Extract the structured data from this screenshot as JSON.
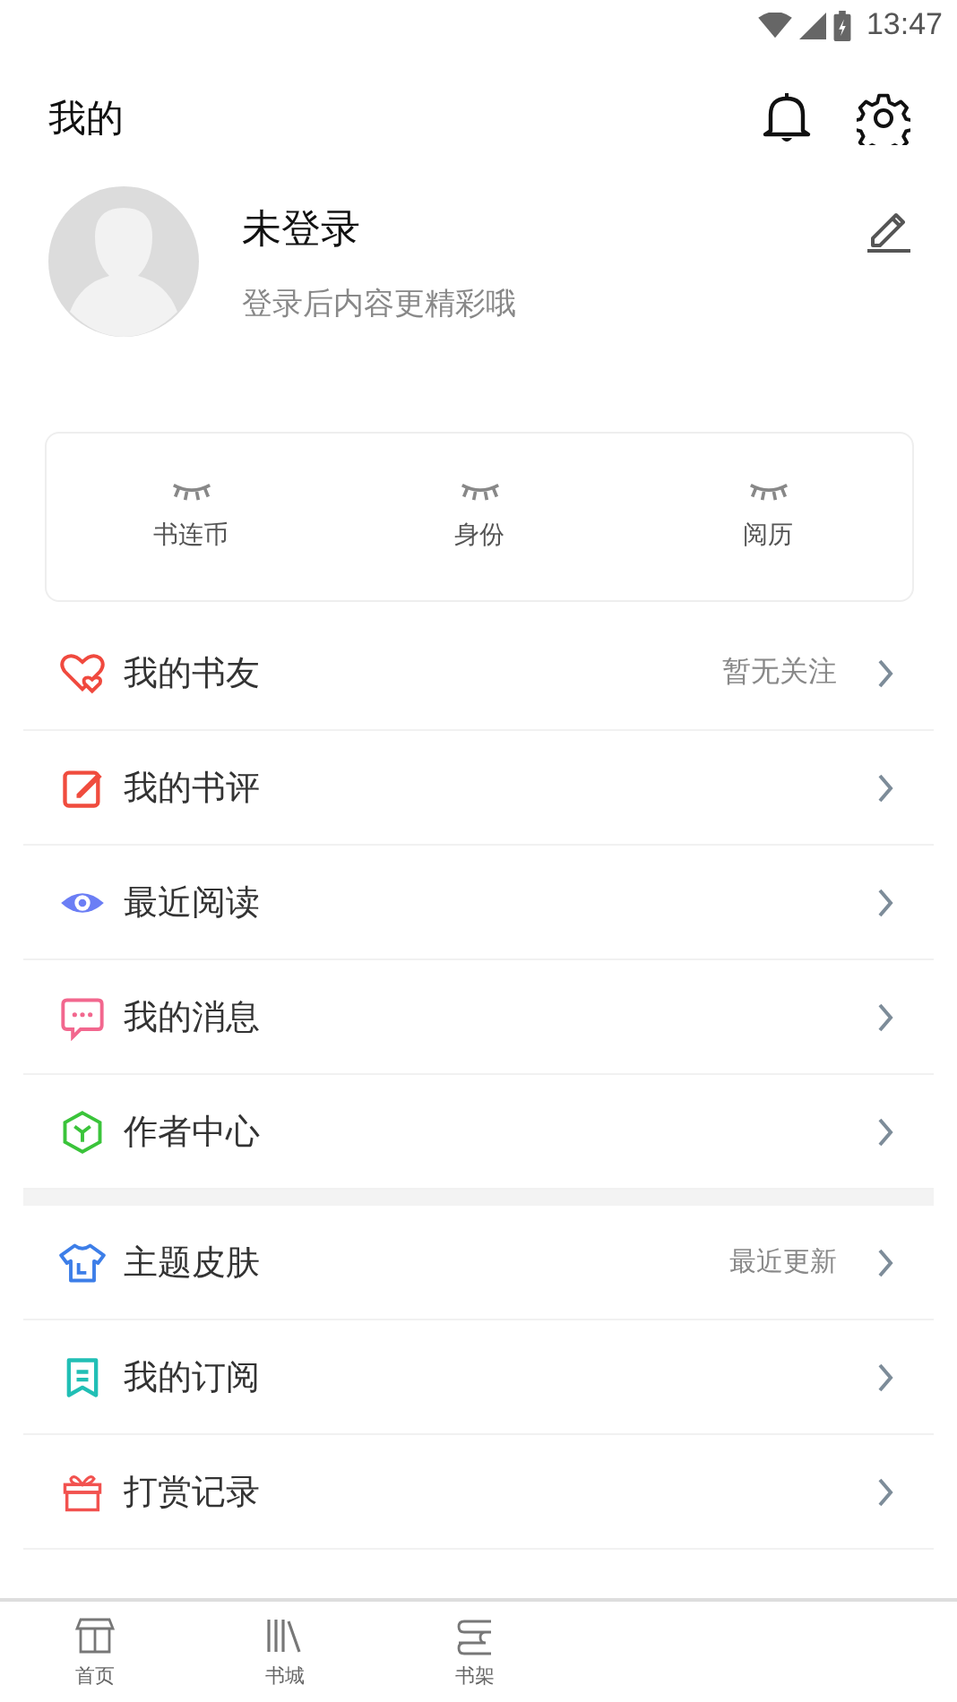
{
  "status_bar": {
    "time": "13:47"
  },
  "header": {
    "title": "我的"
  },
  "profile": {
    "name": "未登录",
    "hint": "登录后内容更精彩哦"
  },
  "stats": [
    {
      "label": "书连币"
    },
    {
      "label": "身份"
    },
    {
      "label": "阅历"
    }
  ],
  "menu_groups": [
    {
      "items": [
        {
          "label": "我的书友",
          "note": "暂无关注"
        },
        {
          "label": "我的书评"
        },
        {
          "label": "最近阅读"
        },
        {
          "label": "我的消息"
        },
        {
          "label": "作者中心"
        }
      ]
    },
    {
      "items": [
        {
          "label": "主题皮肤",
          "note": "最近更新"
        },
        {
          "label": "我的订阅"
        },
        {
          "label": "打赏记录"
        }
      ]
    }
  ],
  "tab_bar": [
    {
      "label": "首页",
      "selected": false
    },
    {
      "label": "书城",
      "selected": false
    },
    {
      "label": "书架",
      "selected": false
    }
  ]
}
